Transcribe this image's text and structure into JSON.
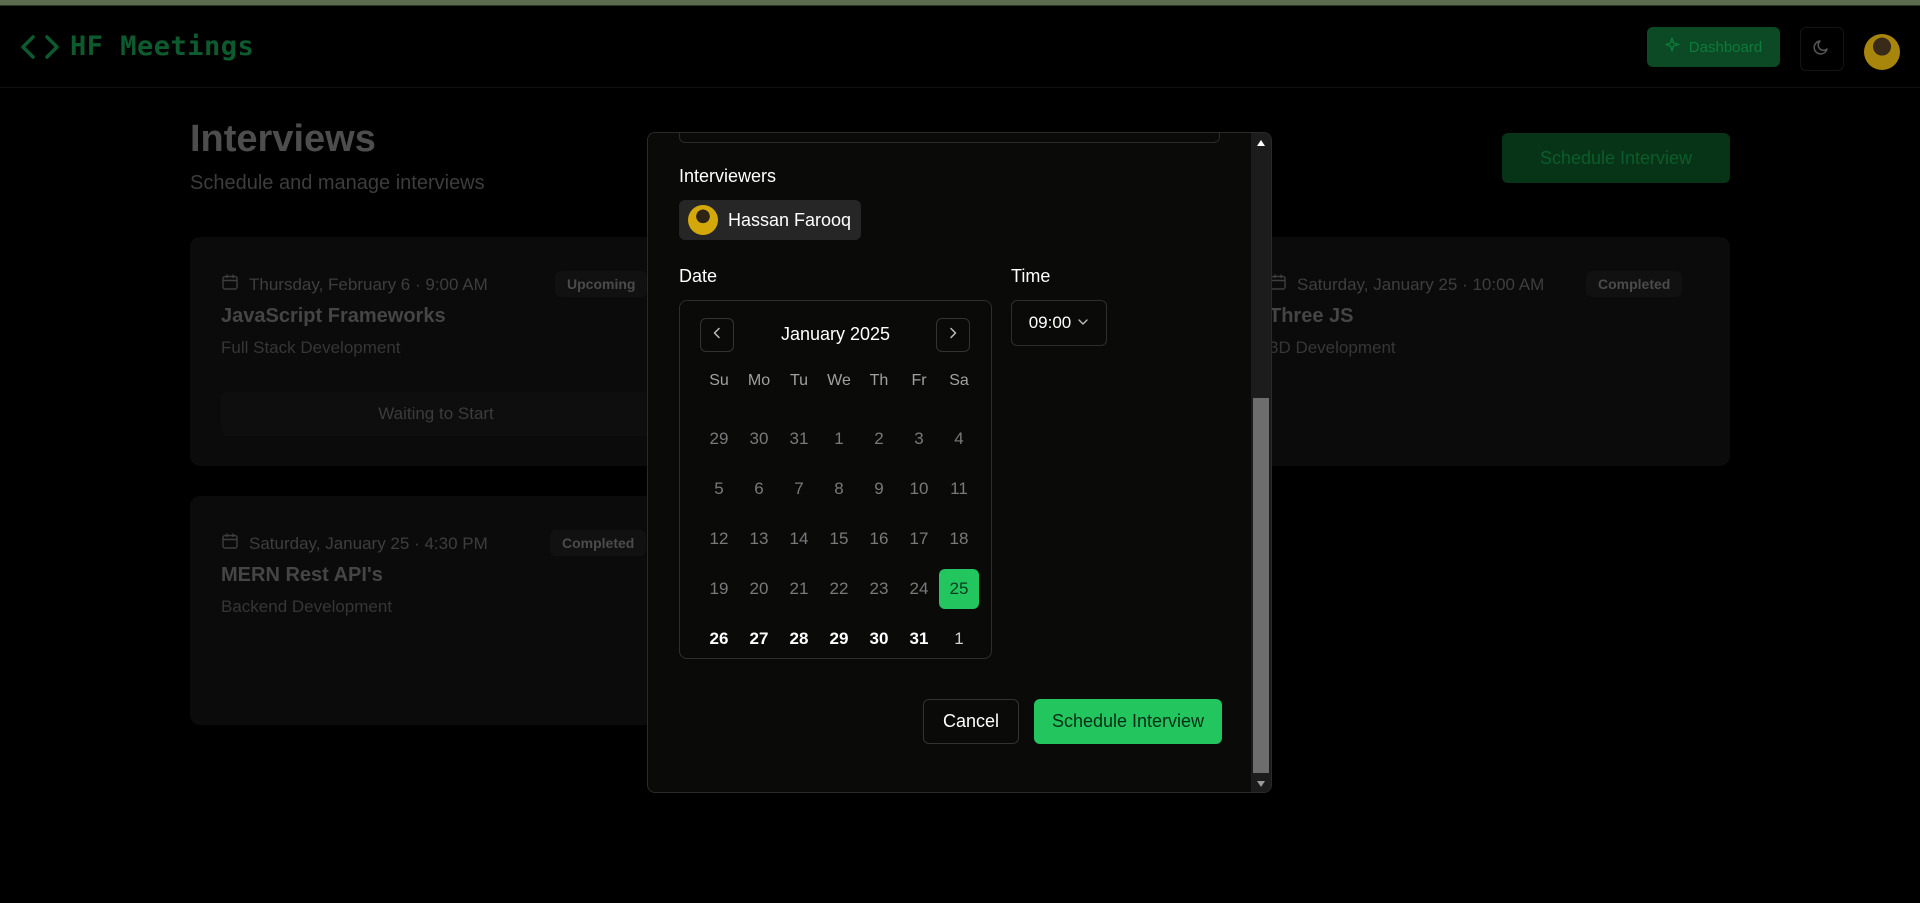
{
  "navbar": {
    "logo_text": "HF Meetings",
    "dashboard_label": "Dashboard"
  },
  "page": {
    "title": "Interviews",
    "subtitle": "Schedule and manage interviews",
    "schedule_button": "Schedule Interview"
  },
  "cards": [
    {
      "date": "Thursday, February 6 · 9:00 AM",
      "status": "Upcoming",
      "title": "JavaScript Frameworks",
      "subtitle": "Full Stack Development",
      "action": "Waiting to Start"
    },
    {
      "date": "Saturday, January 25 · 10:00 AM",
      "status": "Completed",
      "title": "Three JS",
      "subtitle": "3D Development"
    },
    {
      "date": "Saturday, January 25 · 4:30 PM",
      "status": "Completed",
      "title": "MERN Rest API's",
      "subtitle": "Backend Development"
    }
  ],
  "modal": {
    "interviewers_label": "Interviewers",
    "interviewer_name": "Hassan Farooq",
    "date_label": "Date",
    "time_label": "Time",
    "time_value": "09:00",
    "calendar": {
      "month_label": "January 2025",
      "weekdays": [
        "Su",
        "Mo",
        "Tu",
        "We",
        "Th",
        "Fr",
        "Sa"
      ],
      "weeks": [
        [
          "29",
          "30",
          "31",
          "1",
          "2",
          "3",
          "4"
        ],
        [
          "5",
          "6",
          "7",
          "8",
          "9",
          "10",
          "11"
        ],
        [
          "12",
          "13",
          "14",
          "15",
          "16",
          "17",
          "18"
        ],
        [
          "19",
          "20",
          "21",
          "22",
          "23",
          "24",
          "25"
        ],
        [
          "26",
          "27",
          "28",
          "29",
          "30",
          "31",
          "1"
        ]
      ],
      "selected_day": "25"
    },
    "cancel_label": "Cancel",
    "schedule_label": "Schedule Interview"
  },
  "colors": {
    "accent": "#22c55e",
    "background": "#000000",
    "modal_background": "#0a0a09"
  }
}
